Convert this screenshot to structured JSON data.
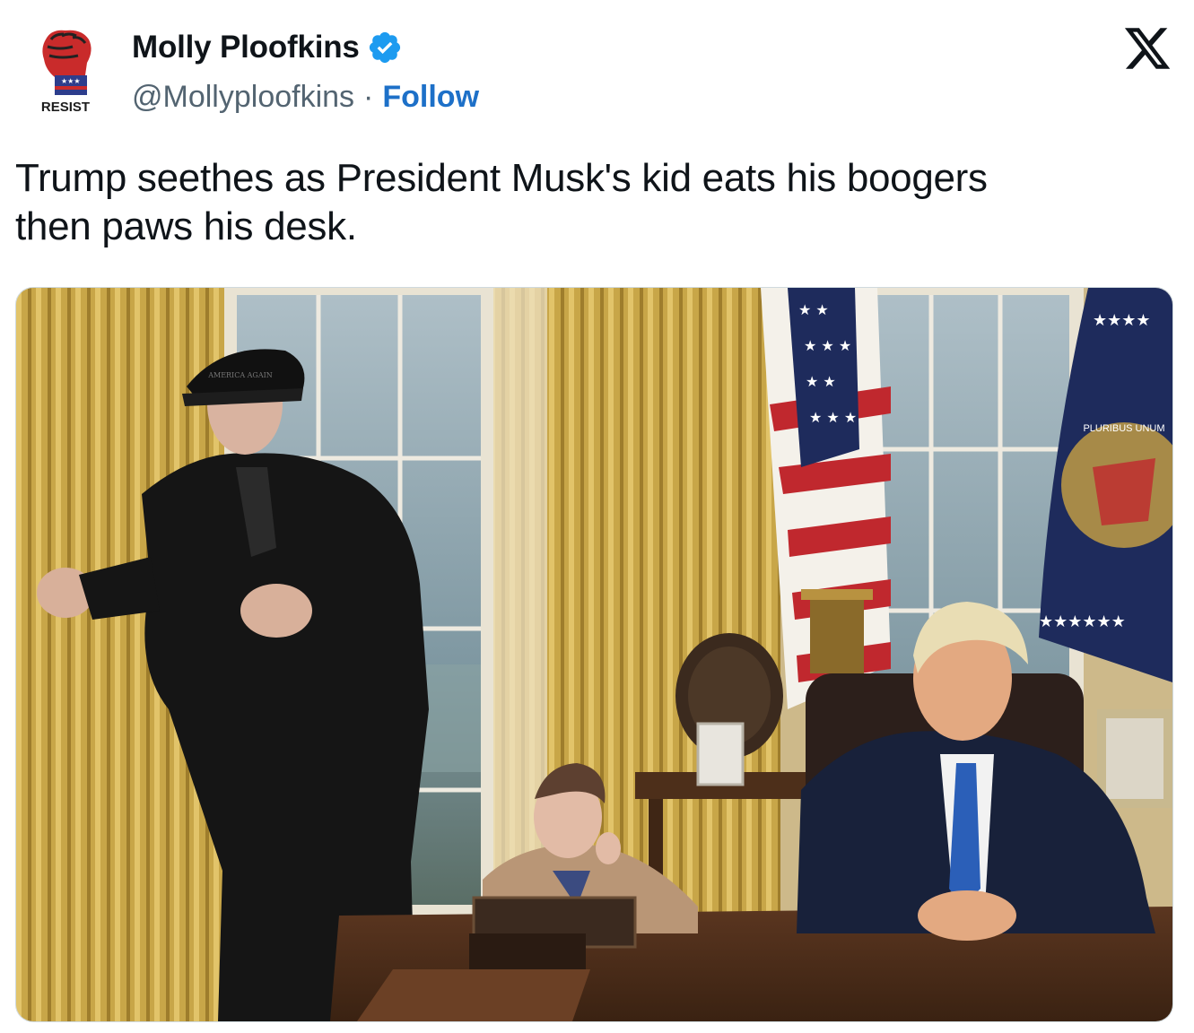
{
  "author": {
    "display_name": "Molly Ploofkins",
    "handle": "@Mollyploofkins",
    "separator": "·",
    "follow_label": "Follow",
    "avatar_text": "RESIST",
    "verified": true
  },
  "post": {
    "text": "Trump seethes as President Musk's kid eats his boogers\nthen paws his desk."
  },
  "photo": {
    "hat_text": "AMERICA AGAIN",
    "seal_text": "PLURIBUS UNUM"
  },
  "colors": {
    "follow": "#1d70c8",
    "verified": "#1d9bf0",
    "curtain": "#c9a64a",
    "flag_red": "#c0282e",
    "flag_blue": "#1e2b5c"
  },
  "icons": [
    "resist-fist-avatar",
    "verified-badge-icon",
    "x-logo-icon"
  ]
}
